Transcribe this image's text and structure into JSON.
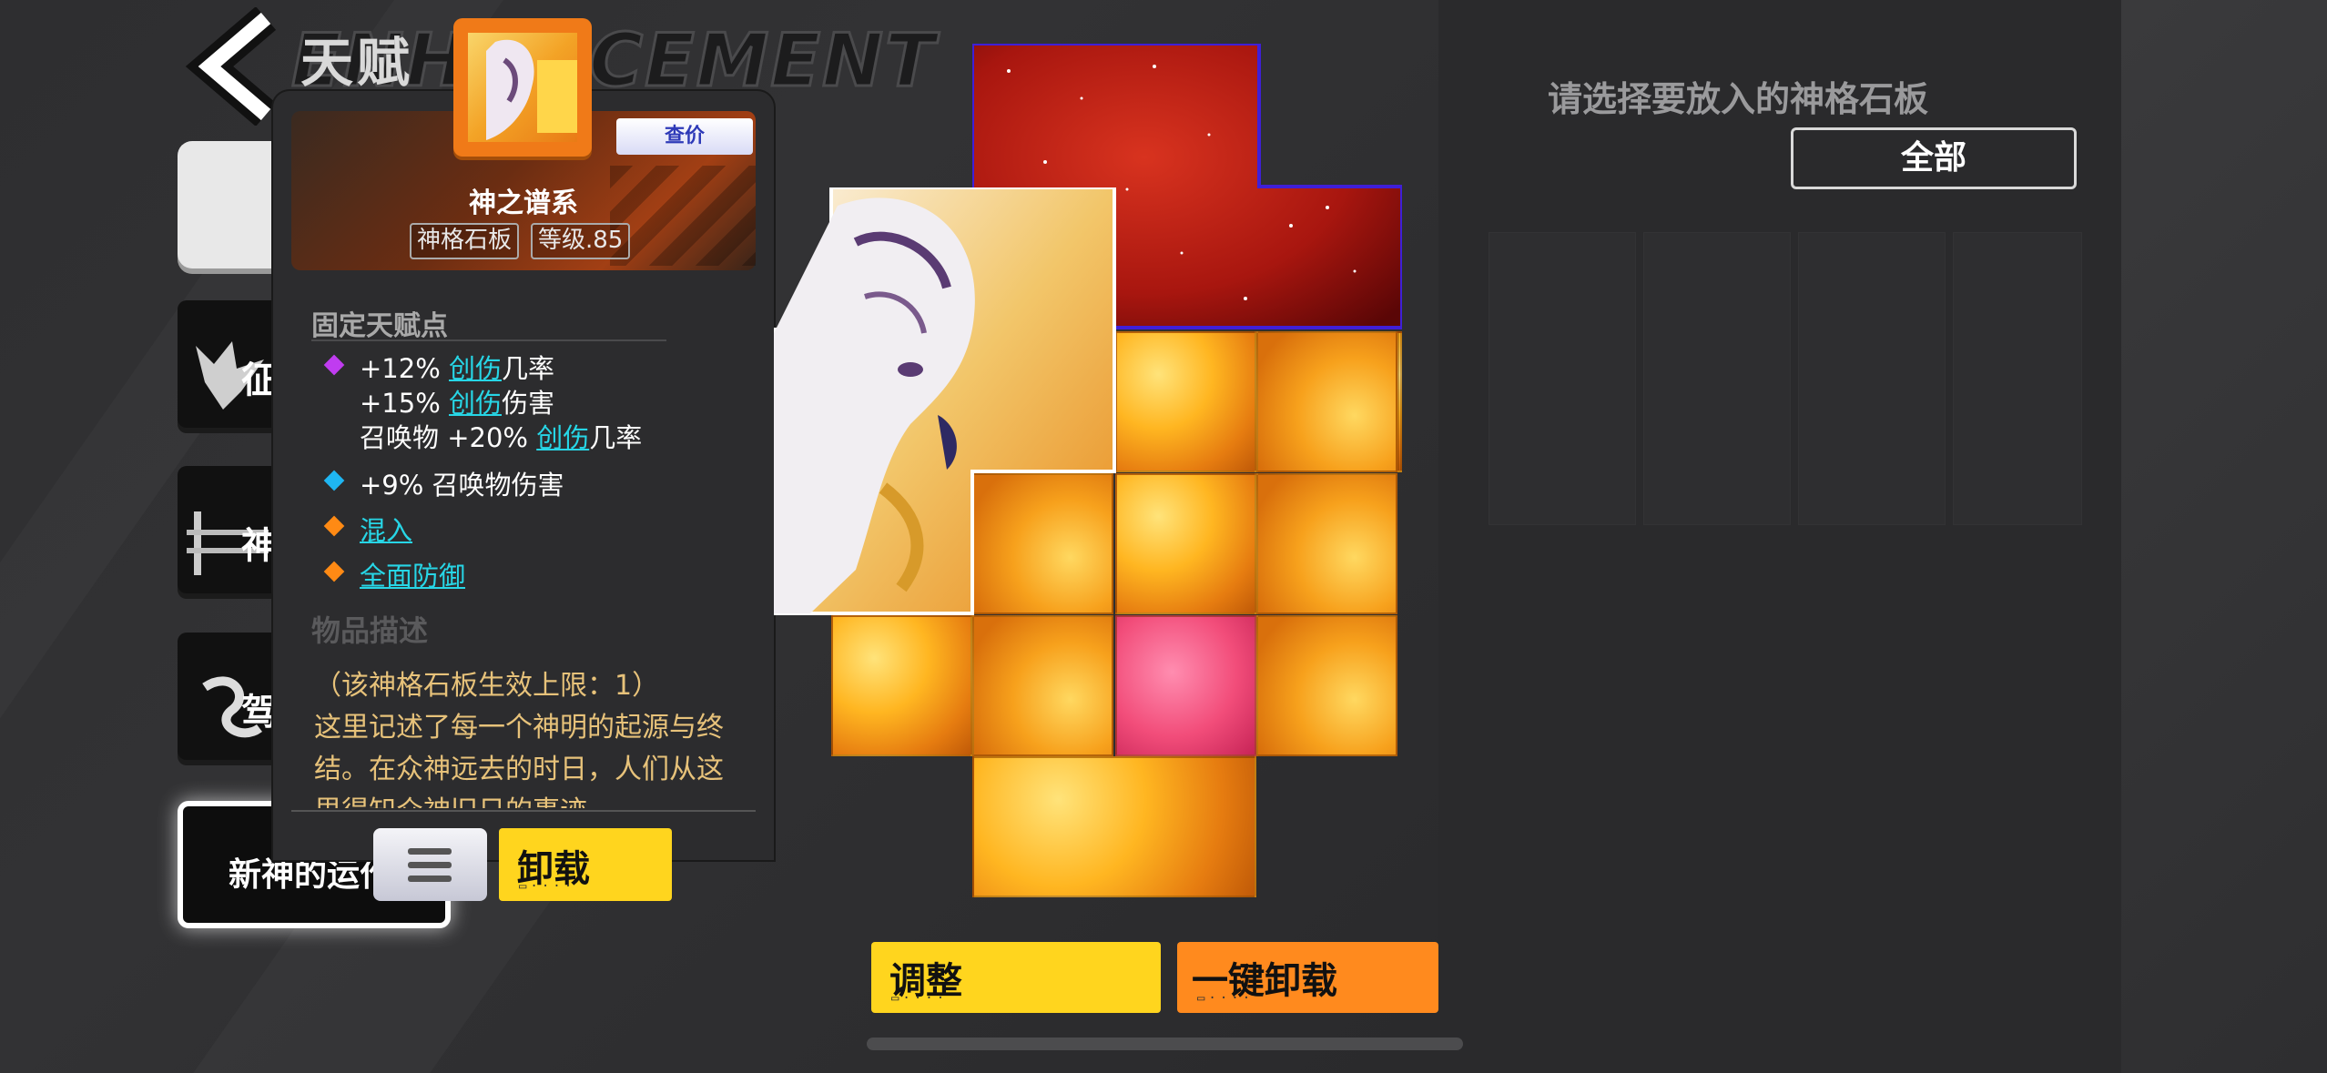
{
  "screen": {
    "title_cn": "天赋",
    "title_watermark": "ENHANCEMENT"
  },
  "side_menu": {
    "items": [
      {
        "label": "征",
        "icon": "demon-icon"
      },
      {
        "label": "神",
        "icon": "sword-icon"
      },
      {
        "label": "驾",
        "icon": "dragon-icon"
      }
    ],
    "selected_label": "新神的运作"
  },
  "tooltip": {
    "price_button": "查价",
    "item_name": "神之谱系",
    "item_type": "神格石板",
    "item_level": "等级.85",
    "fixed_section_title": "固定天赋点",
    "fixed_lines": [
      {
        "gem": "purple",
        "prefix": "+12% ",
        "keyword": "创伤",
        "suffix": "几率"
      },
      {
        "gem": "",
        "prefix": "+15% ",
        "keyword": "创伤",
        "suffix": "伤害"
      },
      {
        "gem": "",
        "prefix": "召唤物 +20% ",
        "keyword": "创伤",
        "suffix": "几率"
      },
      {
        "gem": "blue",
        "prefix": "+9% 召唤物伤害",
        "keyword": "",
        "suffix": ""
      },
      {
        "gem": "orange",
        "prefix": "",
        "keyword": "混入",
        "suffix": ""
      },
      {
        "gem": "orange",
        "prefix": "",
        "keyword": "全面防御",
        "suffix": ""
      }
    ],
    "description_title": "物品描述",
    "description_lines": [
      "（该神格石板生效上限：1）",
      "这里记述了每一个神明的起源与终",
      "结。在众神远去的时日，人们从这",
      "里得知众神旧日的事迹。"
    ]
  },
  "actions": {
    "menu_icon": "hamburger-icon",
    "unload": "卸载",
    "adjust": "调整",
    "unload_all": "一键卸载"
  },
  "right_panel": {
    "prompt": "请选择要放入的神格石板",
    "filter_all": "全部"
  },
  "colors": {
    "accent_yellow": "#ffd51e",
    "accent_orange": "#ff8a1e",
    "keyword_cyan": "#27d6e6",
    "description_gold": "#e7c27a",
    "gem_purple": "#c03cf0",
    "gem_blue": "#1fb6f2",
    "gem_orange": "#ff8a14"
  }
}
